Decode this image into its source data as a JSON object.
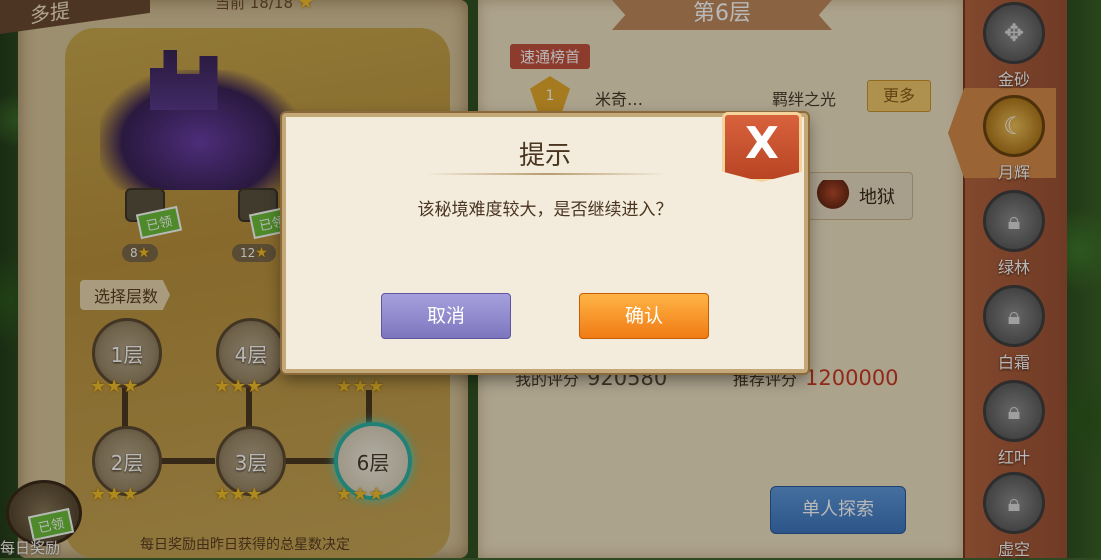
{
  "left": {
    "ribbon_label": "多提",
    "top_count": "当前 18/18",
    "chests": [
      {
        "claim": "已领",
        "stars": "8"
      },
      {
        "claim": "已领",
        "stars": "12"
      }
    ],
    "choose_floor": "选择层数",
    "floors": [
      {
        "label": "1层"
      },
      {
        "label": "4层"
      },
      {
        "label": "2层"
      },
      {
        "label": "3层"
      },
      {
        "label": "6层"
      }
    ],
    "daily_claim": "已领",
    "daily_label": "每日奖励",
    "footnote": "每日奖励由昨日获得的总星数决定"
  },
  "right": {
    "floor_title": "第6层",
    "speed_tag": "速通榜首",
    "rank_medal": "1",
    "rank_name": "米奇…",
    "rank_team": "羁绊之光",
    "more": "更多",
    "difficulty": "地狱",
    "my_score_label": "我的评分",
    "my_score": "920580",
    "rec_score_label": "推荐评分",
    "rec_score": "1200000",
    "explore": "单人探索"
  },
  "sidebar": {
    "realms": [
      {
        "label": "金砂",
        "icon": "ornament-icon",
        "active": false
      },
      {
        "label": "月辉",
        "icon": "moon-icon",
        "active": true
      },
      {
        "label": "绿林",
        "icon": "lock-icon",
        "active": false
      },
      {
        "label": "白霜",
        "icon": "lock-icon",
        "active": false
      },
      {
        "label": "红叶",
        "icon": "lock-icon",
        "active": false
      },
      {
        "label": "虚空",
        "icon": "lock-icon",
        "active": false
      }
    ]
  },
  "dialog": {
    "title": "提示",
    "message": "该秘境难度较大，是否继续进入？",
    "cancel": "取消",
    "confirm": "确认",
    "close": "X"
  },
  "colors": {
    "accent_orange": "#f07b14",
    "cancel_purple": "#7d76be",
    "score_red": "#c83a22",
    "current_floor_ring": "#2fb3a6"
  }
}
